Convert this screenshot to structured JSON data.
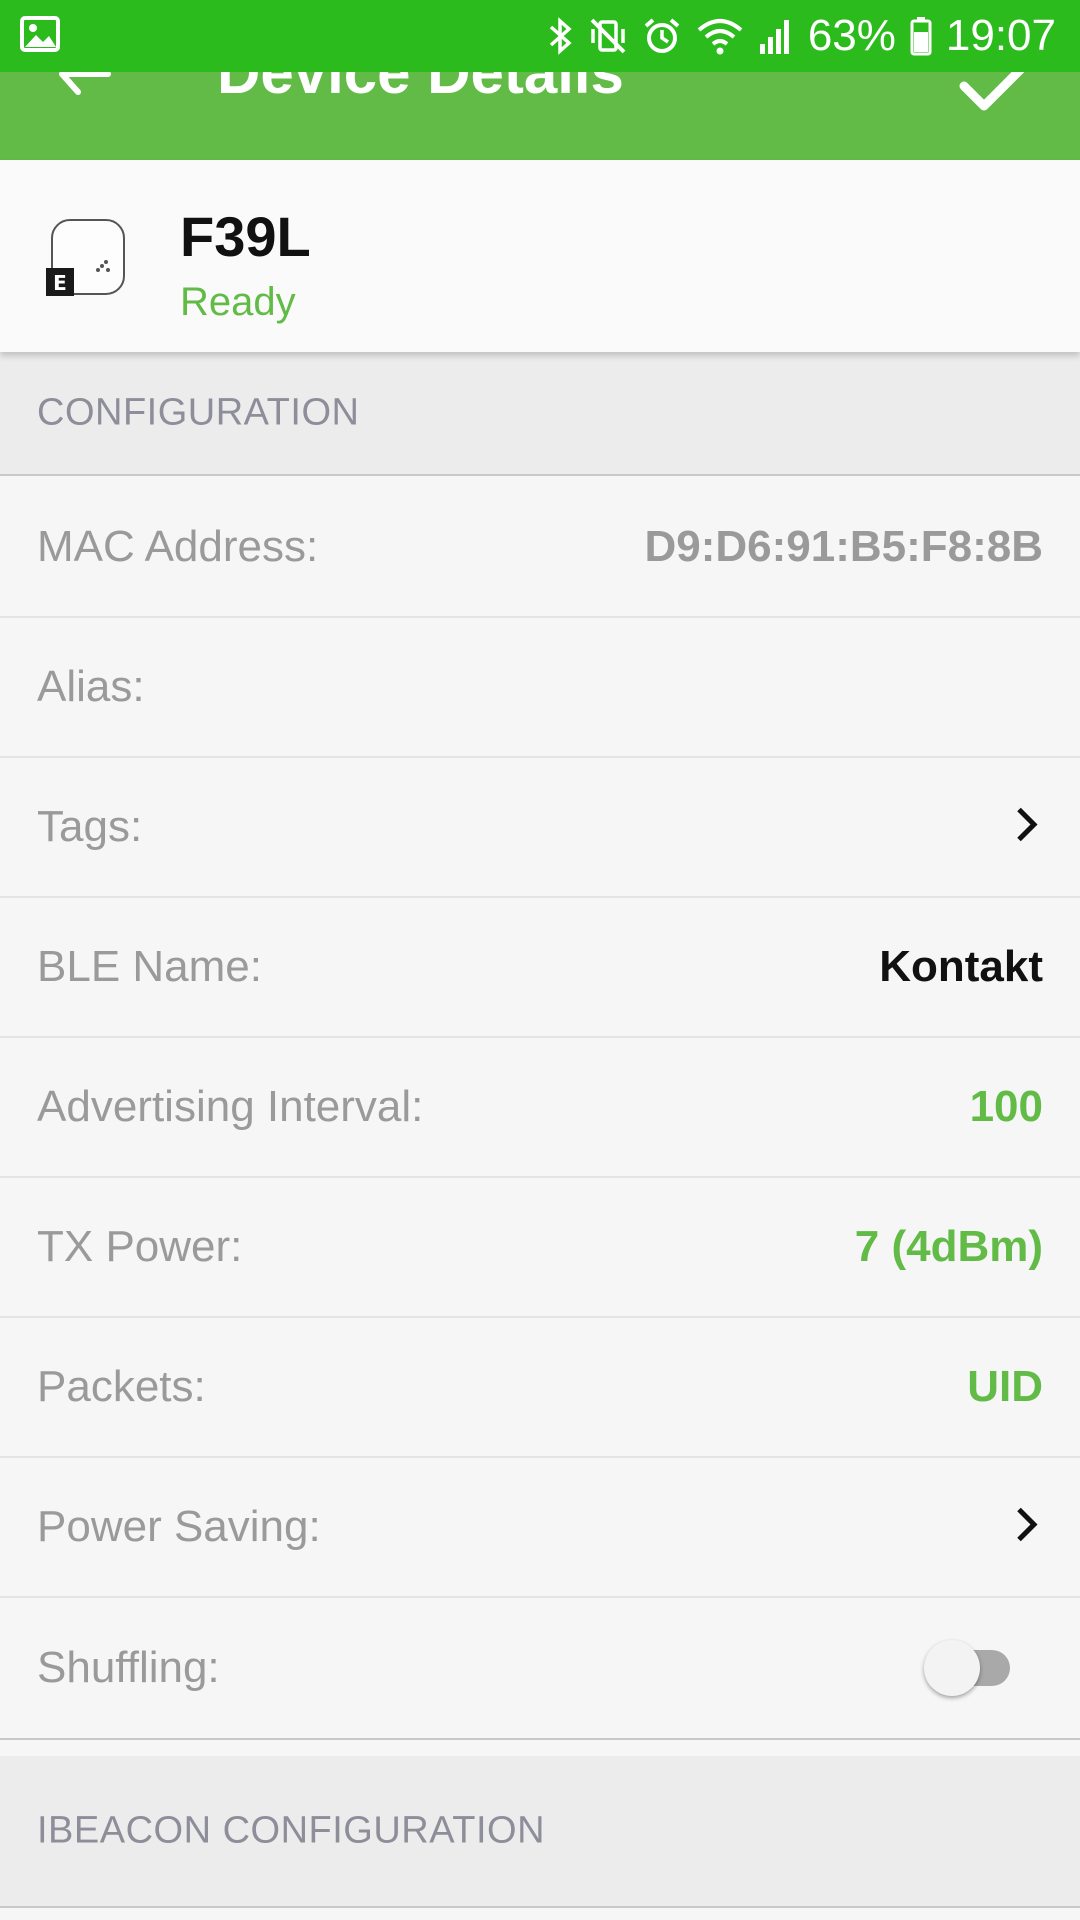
{
  "status_bar": {
    "battery_percent": "63%",
    "time": "19:07"
  },
  "app_bar": {
    "title": "Device Details"
  },
  "device": {
    "name": "F39L",
    "status": "Ready",
    "badge": "E"
  },
  "sections": {
    "configuration": "CONFIGURATION",
    "ibeacon": "IBEACON CONFIGURATION"
  },
  "rows": {
    "mac_address": {
      "label": "MAC Address:",
      "value": "D9:D6:91:B5:F8:8B"
    },
    "alias": {
      "label": "Alias:",
      "value": ""
    },
    "tags": {
      "label": "Tags:"
    },
    "ble_name": {
      "label": "BLE Name:",
      "value": "Kontakt"
    },
    "advertising_interval": {
      "label": "Advertising Interval:",
      "value": "100"
    },
    "tx_power": {
      "label": "TX Power:",
      "value": "7 (4dBm)"
    },
    "packets": {
      "label": "Packets:",
      "value": "UID"
    },
    "power_saving": {
      "label": "Power Saving:"
    },
    "shuffling": {
      "label": "Shuffling:",
      "enabled": false
    }
  },
  "colors": {
    "status_bar": "#2cbb1c",
    "app_bar": "#63bb47",
    "accent_green": "#63bb47"
  }
}
